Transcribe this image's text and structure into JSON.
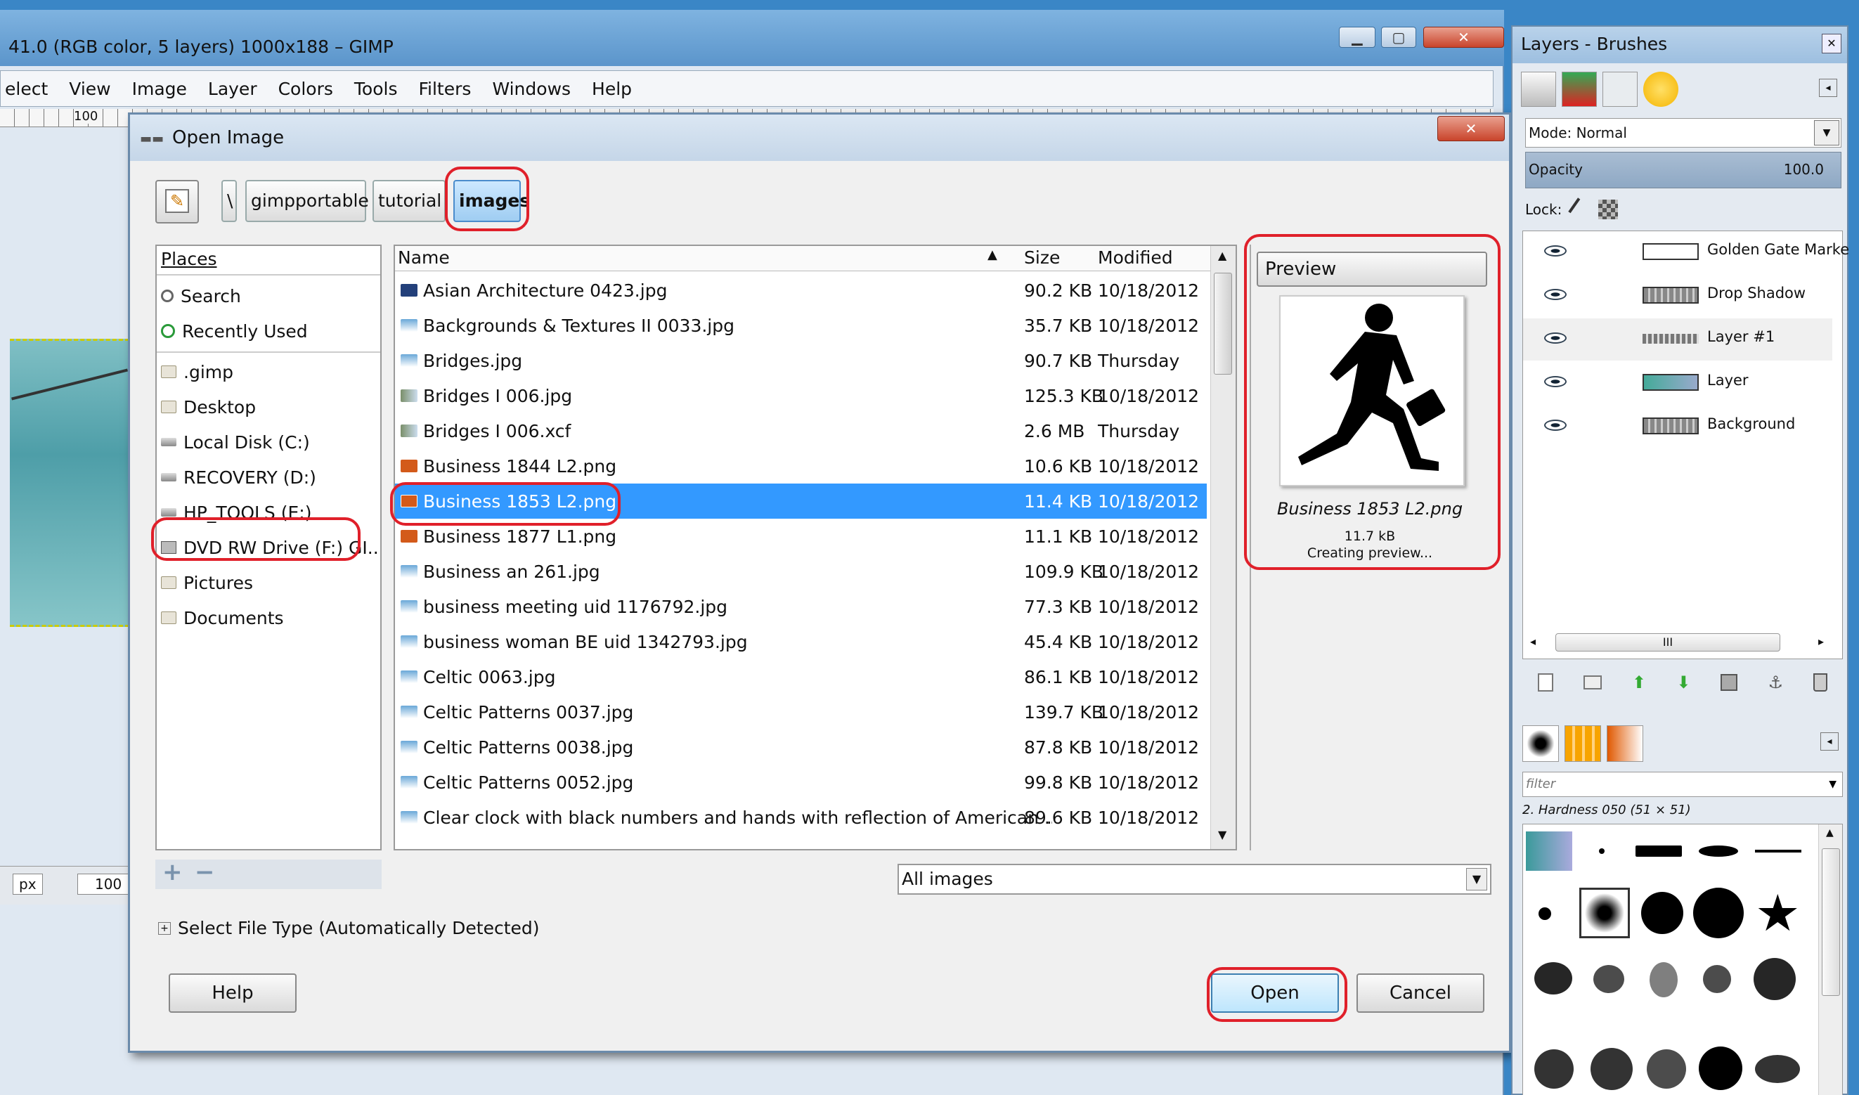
{
  "gimp_window": {
    "title": "41.0 (RGB color, 5 layers) 1000x188 – GIMP",
    "menu": [
      "elect",
      "View",
      "Image",
      "Layer",
      "Colors",
      "Tools",
      "Filters",
      "Windows",
      "Help"
    ],
    "ruler_mark": "100",
    "unit_select": "px",
    "zoom_value": "100"
  },
  "dialog": {
    "title": "Open Image",
    "breadcrumb": [
      "\\",
      "gimpportable",
      "tutorial",
      "images"
    ],
    "places_header": "Places",
    "places": [
      {
        "label": "Search",
        "icon": "search-icon"
      },
      {
        "label": "Recently Used",
        "icon": "recent-icon"
      },
      {
        "label": ".gimp",
        "icon": "folder-icon"
      },
      {
        "label": "Desktop",
        "icon": "folder-icon"
      },
      {
        "label": "Local Disk (C:)",
        "icon": "drive-icon"
      },
      {
        "label": "RECOVERY (D:)",
        "icon": "drive-icon"
      },
      {
        "label": "HP_TOOLS (E:)",
        "icon": "drive-icon"
      },
      {
        "label": "DVD RW Drive (F:) GI..",
        "icon": "dvd-icon"
      },
      {
        "label": "Pictures",
        "icon": "folder-icon"
      },
      {
        "label": "Documents",
        "icon": "folder-icon"
      }
    ],
    "columns": {
      "name": "Name",
      "size": "Size",
      "modified": "Modified"
    },
    "files": [
      {
        "name": "Asian Architecture 0423.jpg",
        "size": "90.2 KB",
        "modified": "10/18/2012"
      },
      {
        "name": "Backgrounds & Textures II 0033.jpg",
        "size": "35.7 KB",
        "modified": "10/18/2012"
      },
      {
        "name": "Bridges.jpg",
        "size": "90.7 KB",
        "modified": "Thursday"
      },
      {
        "name": "Bridges I 006.jpg",
        "size": "125.3 KB",
        "modified": "10/18/2012"
      },
      {
        "name": "Bridges I 006.xcf",
        "size": "2.6 MB",
        "modified": "Thursday"
      },
      {
        "name": "Business 1844 L2.png",
        "size": "10.6 KB",
        "modified": "10/18/2012"
      },
      {
        "name": "Business 1853 L2.png",
        "size": "11.4 KB",
        "modified": "10/18/2012"
      },
      {
        "name": "Business 1877 L1.png",
        "size": "11.1 KB",
        "modified": "10/18/2012"
      },
      {
        "name": "Business an 261.jpg",
        "size": "109.9 KB",
        "modified": "10/18/2012"
      },
      {
        "name": "business meeting uid 1176792.jpg",
        "size": "77.3 KB",
        "modified": "10/18/2012"
      },
      {
        "name": "business woman BE uid 1342793.jpg",
        "size": "45.4 KB",
        "modified": "10/18/2012"
      },
      {
        "name": "Celtic 0063.jpg",
        "size": "86.1 KB",
        "modified": "10/18/2012"
      },
      {
        "name": "Celtic Patterns 0037.jpg",
        "size": "139.7 KB",
        "modified": "10/18/2012"
      },
      {
        "name": "Celtic Patterns 0038.jpg",
        "size": "87.8 KB",
        "modified": "10/18/2012"
      },
      {
        "name": "Celtic Patterns 0052.jpg",
        "size": "99.8 KB",
        "modified": "10/18/2012"
      },
      {
        "name": "Clear clock with black numbers and hands with reflection of American ...",
        "size": "89.6 KB",
        "modified": "10/18/2012"
      }
    ],
    "selected_index": 6,
    "preview": {
      "header": "Preview",
      "filename": "Business 1853 L2.png",
      "size": "11.7 kB",
      "status": "Creating preview..."
    },
    "filter": "All images",
    "file_type_toggle": "Select File Type (Automatically Detected)",
    "buttons": {
      "help": "Help",
      "open": "Open",
      "cancel": "Cancel"
    },
    "add_remove": [
      "+",
      "−"
    ]
  },
  "layers_panel": {
    "title": "Layers - Brushes",
    "mode_label": "Mode: Normal",
    "opacity_label": "Opacity",
    "opacity_value": "100.0",
    "lock_label": "Lock:",
    "layers": [
      "Golden Gate Marke",
      "Drop Shadow",
      "Layer #1",
      "Layer",
      "Background"
    ],
    "scroll_mark": "III",
    "brush_filter_placeholder": "filter",
    "brush_name": "2. Hardness 050 (51 × 51)"
  },
  "colors": {
    "desktop": "#3a86c6",
    "selection": "#3399ff",
    "highlight": "#e0202a"
  }
}
